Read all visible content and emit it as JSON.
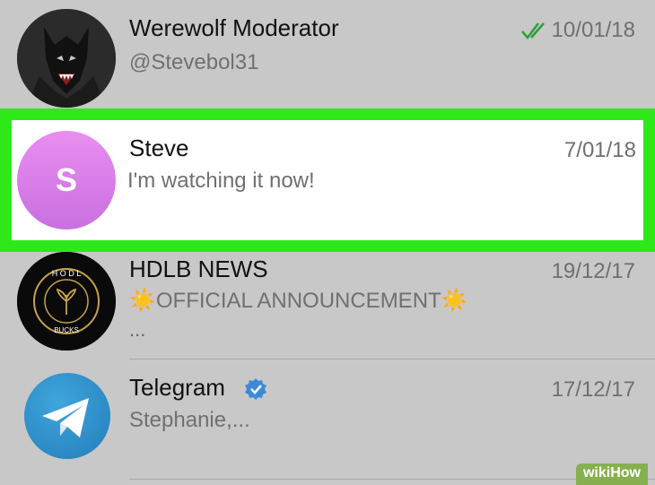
{
  "chats": [
    {
      "name": "Werewolf Moderator",
      "preview": "@Stevebol31",
      "date": "10/01/18",
      "read_status": "double-check-icon",
      "avatar": "werewolf-image"
    },
    {
      "name": "Steve",
      "preview": "I'm watching it now!",
      "date": "7/01/18",
      "avatar_initial": "S",
      "highlighted": true
    },
    {
      "name": "HDLB NEWS",
      "preview": "☀️OFFICIAL ANNOUNCEMENT☀️",
      "preview_more": "...",
      "date": "19/12/17",
      "avatar": "hodl-bucks-logo"
    },
    {
      "name": "Telegram",
      "preview": "Stephanie,...",
      "date": "17/12/17",
      "verified": true,
      "avatar": "telegram-logo"
    }
  ],
  "watermark": {
    "part1": "wiki",
    "part2": "How"
  },
  "colors": {
    "highlight_border": "#2ee91a",
    "check_green": "#2aa138",
    "verified_blue": "#3b8ad8"
  }
}
